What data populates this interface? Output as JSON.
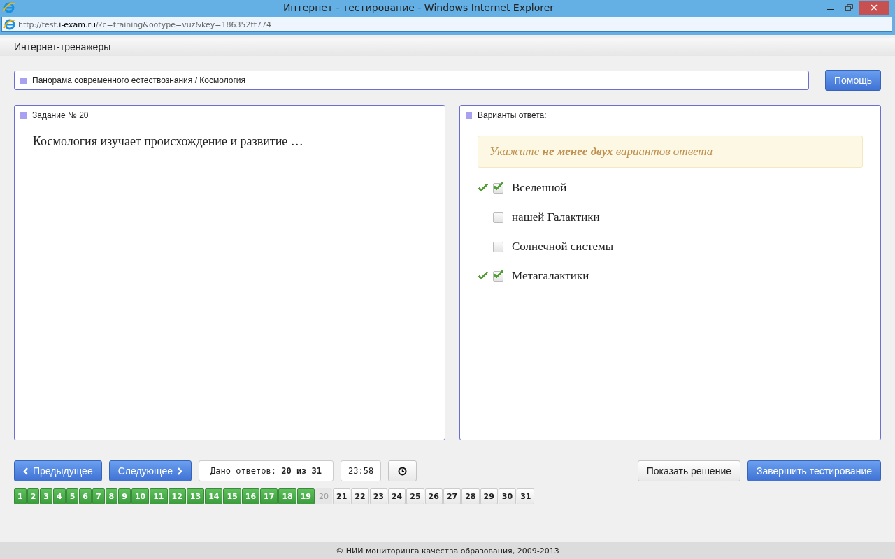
{
  "window": {
    "title": "Интернет - тестирование - Windows Internet Explorer"
  },
  "address": {
    "prefix": "http://test.",
    "domain": "i-exam.ru",
    "path": "/?c=training&ootype=vuz&key=186352tt774"
  },
  "site_title": "Интернет-тренажеры",
  "breadcrumb": "Панорама современного естествознания / Космология",
  "help_button": "Помощь",
  "task": {
    "title": "Задание № 20",
    "question": "Космология изучает происхождение и развитие …"
  },
  "answers": {
    "title": "Варианты ответа:",
    "hint": "Укажите **не менее двух** вариантов ответа",
    "options": [
      {
        "label": "Вселенной",
        "checked": true,
        "correct": true
      },
      {
        "label": "нашей Галактики",
        "checked": false,
        "correct": false
      },
      {
        "label": "Солнечной системы",
        "checked": false,
        "correct": false
      },
      {
        "label": "Метагалактики",
        "checked": true,
        "correct": true
      }
    ]
  },
  "nav": {
    "prev": "Предыдущее",
    "next": "Следующее",
    "given_label": "Дано ответов:",
    "given_value": "20 из 31",
    "timer": "23:58",
    "show_solution": "Показать решение",
    "finish": "Завершить тестирование"
  },
  "pages": [
    {
      "label": "1",
      "answered": true,
      "selected": false
    },
    {
      "label": "2",
      "answered": true,
      "selected": false
    },
    {
      "label": "3",
      "answered": true,
      "selected": false
    },
    {
      "label": "4",
      "answered": true,
      "selected": false
    },
    {
      "label": "5",
      "answered": true,
      "selected": false
    },
    {
      "label": "6",
      "answered": true,
      "selected": false
    },
    {
      "label": "7",
      "answered": true,
      "selected": false
    },
    {
      "label": "8",
      "answered": true,
      "selected": false
    },
    {
      "label": "9",
      "answered": true,
      "selected": false
    },
    {
      "label": "10",
      "answered": true,
      "selected": false
    },
    {
      "label": "11",
      "answered": true,
      "selected": false
    },
    {
      "label": "12",
      "answered": true,
      "selected": false
    },
    {
      "label": "13",
      "answered": true,
      "selected": false
    },
    {
      "label": "14",
      "answered": true,
      "selected": false
    },
    {
      "label": "15",
      "answered": true,
      "selected": false
    },
    {
      "label": "16",
      "answered": true,
      "selected": false
    },
    {
      "label": "17",
      "answered": true,
      "selected": false
    },
    {
      "label": "18",
      "answered": true,
      "selected": false
    },
    {
      "label": "19",
      "answered": true,
      "selected": false
    },
    {
      "label": "20",
      "answered": false,
      "selected": true
    },
    {
      "label": "21",
      "answered": false,
      "selected": false
    },
    {
      "label": "22",
      "answered": false,
      "selected": false
    },
    {
      "label": "23",
      "answered": false,
      "selected": false
    },
    {
      "label": "24",
      "answered": false,
      "selected": false
    },
    {
      "label": "25",
      "answered": false,
      "selected": false
    },
    {
      "label": "26",
      "answered": false,
      "selected": false
    },
    {
      "label": "27",
      "answered": false,
      "selected": false
    },
    {
      "label": "28",
      "answered": false,
      "selected": false
    },
    {
      "label": "29",
      "answered": false,
      "selected": false
    },
    {
      "label": "30",
      "answered": false,
      "selected": false
    },
    {
      "label": "31",
      "answered": false,
      "selected": false
    }
  ],
  "footer": "© НИИ мониторинга качества образования, 2009-2013"
}
